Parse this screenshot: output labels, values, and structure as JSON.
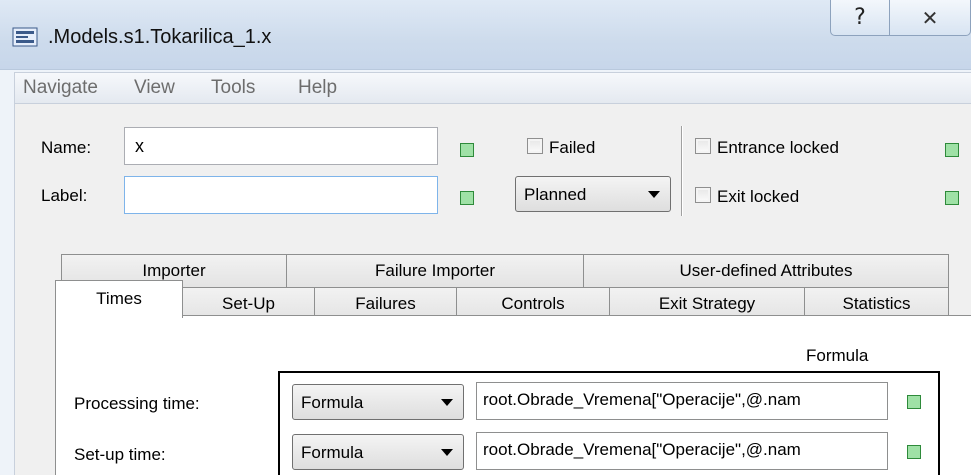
{
  "window": {
    "title": ".Models.s1.Tokarilica_1.x",
    "help_glyph": "?",
    "close_glyph": "✕"
  },
  "menu": [
    "Navigate",
    "View",
    "Tools",
    "Help"
  ],
  "form": {
    "name_label": "Name:",
    "name_value": "x",
    "label_label": "Label:",
    "label_value": "",
    "failed_label": "Failed",
    "failed_checked": false,
    "planned_value": "Planned",
    "entrance_locked_label": "Entrance locked",
    "entrance_locked_checked": false,
    "exit_locked_label": "Exit locked",
    "exit_locked_checked": false
  },
  "tabs_row1": [
    "Importer",
    "Failure Importer",
    "User-defined Attributes"
  ],
  "tabs_row2": [
    "Times",
    "Set-Up",
    "Failures",
    "Controls",
    "Exit Strategy",
    "Statistics"
  ],
  "active_tab": "Times",
  "times": {
    "column_header": "Formula",
    "processing_time_label": "Processing time:",
    "processing_time_mode": "Formula",
    "processing_time_formula": "root.Obrade_Vremena[\"Operacije\",@.nam",
    "setup_time_label": "Set-up time:",
    "setup_time_mode": "Formula",
    "setup_time_formula": "root.Obrade_Vremena[\"Operacije\",@.nam"
  },
  "colors": {
    "indicator_fill": "#9fe1a6",
    "indicator_border": "#2e8a3a",
    "titlebar": "#cddbec"
  }
}
